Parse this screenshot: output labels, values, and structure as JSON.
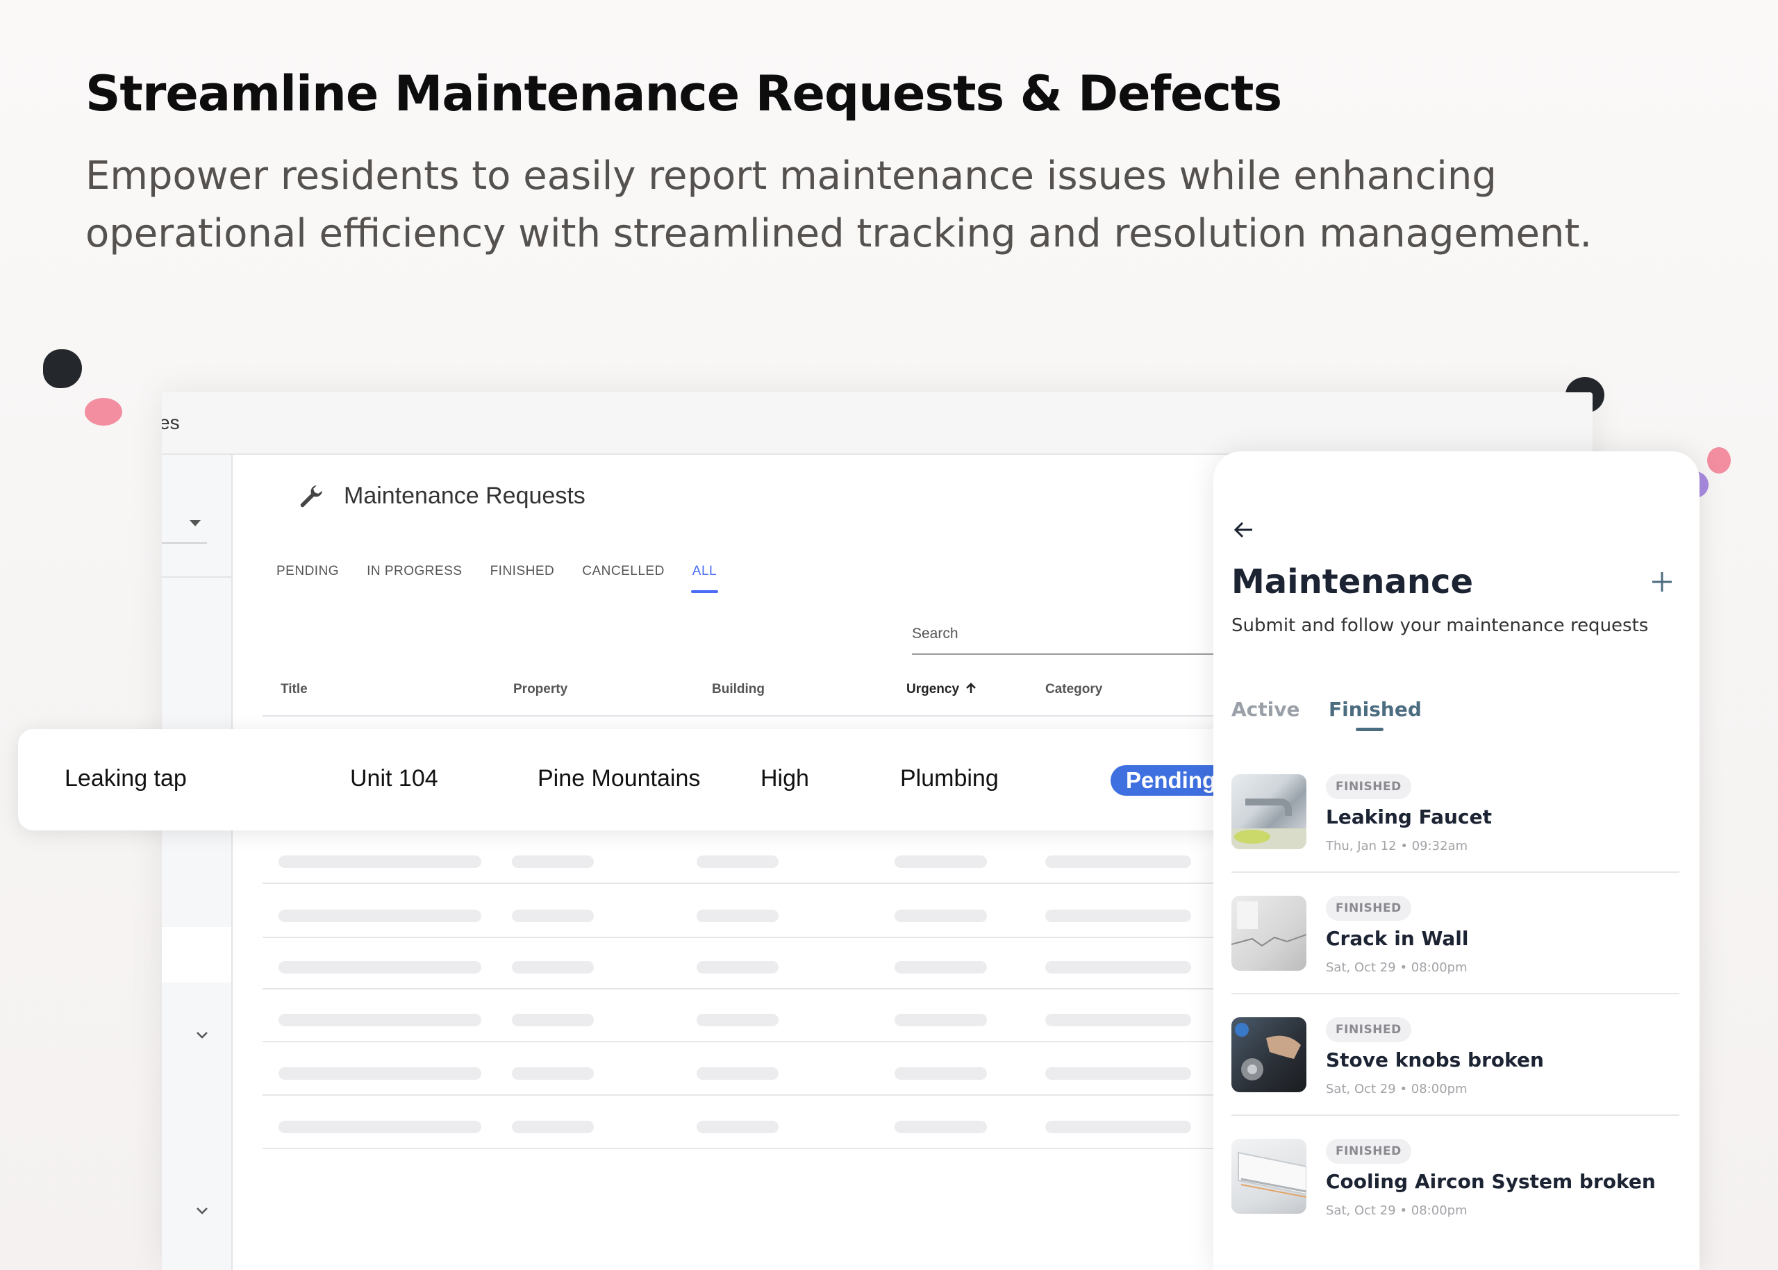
{
  "hero": {
    "title": "Streamline Maintenance Requests & Defects",
    "subtitle": "Empower residents to easily report maintenance issues while enhancing operational efficiency with streamlined tracking and resolution management."
  },
  "colors": {
    "accent_blue": "#4a6cf7",
    "pending_badge": "#3f70e0",
    "mobile_accent": "#4c6c80",
    "dot_dark": "#24272c",
    "dot_pink": "#f28ea0",
    "dot_purple": "#a98be0"
  },
  "desktop": {
    "breadcrumb_fragment": "es",
    "page_title": "Maintenance Requests",
    "page_icon": "wrench-icon",
    "tabs": [
      "PENDING",
      "IN PROGRESS",
      "FINISHED",
      "CANCELLED",
      "ALL"
    ],
    "active_tab": "ALL",
    "search": {
      "placeholder": "Search"
    },
    "columns": {
      "title": "Title",
      "property": "Property",
      "building": "Building",
      "urgency": "Urgency",
      "category": "Category"
    },
    "sorted_column": "Urgency",
    "sort_icon": "arrow-up-icon",
    "highlighted_row": {
      "title": "Leaking tap",
      "property": "Unit 104",
      "building": "Pine Mountains",
      "urgency": "High",
      "category": "Plumbing",
      "status": "Pending"
    }
  },
  "mobile": {
    "title": "Maintenance",
    "subtitle": "Submit and follow your maintenance requests",
    "back_icon": "arrow-left-icon",
    "add_icon": "plus-icon",
    "tabs": {
      "active": "Active",
      "finished": "Finished"
    },
    "selected_tab": "Finished",
    "items": [
      {
        "status": "FINISHED",
        "title": "Leaking Faucet",
        "date": "Thu, Jan 12",
        "time": "09:32am"
      },
      {
        "status": "FINISHED",
        "title": "Crack in Wall",
        "date": "Sat, Oct 29",
        "time": "08:00pm"
      },
      {
        "status": "FINISHED",
        "title": "Stove knobs broken",
        "date": "Sat, Oct 29",
        "time": "08:00pm"
      },
      {
        "status": "FINISHED",
        "title": "Cooling Aircon  System broken",
        "date": "Sat, Oct 29",
        "time": "08:00pm"
      }
    ]
  }
}
